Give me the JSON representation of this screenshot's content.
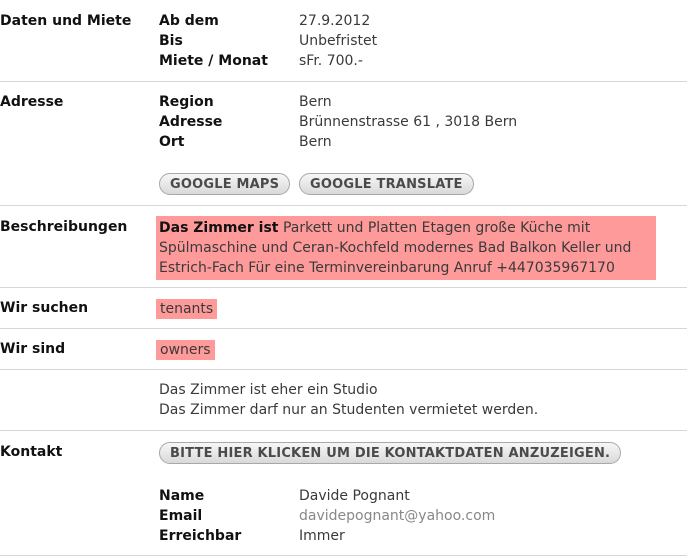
{
  "daten": {
    "title": "Daten und Miete",
    "rows": [
      {
        "label": "Ab dem",
        "value": "27.9.2012"
      },
      {
        "label": "Bis",
        "value": "Unbefristet"
      },
      {
        "label": "Miete / Monat",
        "value": "sFr. 700.-"
      }
    ]
  },
  "adresse": {
    "title": "Adresse",
    "rows": [
      {
        "label": "Region",
        "value": "Bern"
      },
      {
        "label": "Adresse",
        "value": "Brünnenstrasse 61 , 3018 Bern"
      },
      {
        "label": "Ort",
        "value": "Bern"
      }
    ],
    "buttons": {
      "maps": "GOOGLE MAPS",
      "translate": "GOOGLE TRANSLATE"
    }
  },
  "beschreibungen": {
    "title": "Beschreibungen",
    "lead": "Das Zimmer ist",
    "text": " Parkett und Platten Etagen große Küche mit Spülmaschine und Ceran-Kochfeld modernes Bad Balkon Keller und Estrich-Fach Für eine Terminvereinbarung Anruf +447035967170"
  },
  "wir_suchen": {
    "title": "Wir suchen",
    "value": "tenants"
  },
  "wir_sind": {
    "title": "Wir sind",
    "value": "owners"
  },
  "notes": [
    "Das Zimmer ist eher ein Studio",
    "Das Zimmer darf nur an Studenten vermietet werden."
  ],
  "kontakt": {
    "title": "Kontakt",
    "button": "BITTE HIER KLICKEN UM DIE KONTAKTDATEN ANZUZEIGEN.",
    "rows": [
      {
        "label": "Name",
        "value": "Davide Pognant"
      },
      {
        "label": "Email",
        "value": "davidepognant@yahoo.com"
      },
      {
        "label": "Erreichbar",
        "value": "Immer"
      }
    ]
  },
  "colors": {
    "highlight": "#ff9a9a",
    "divider": "#d6d6d6"
  }
}
